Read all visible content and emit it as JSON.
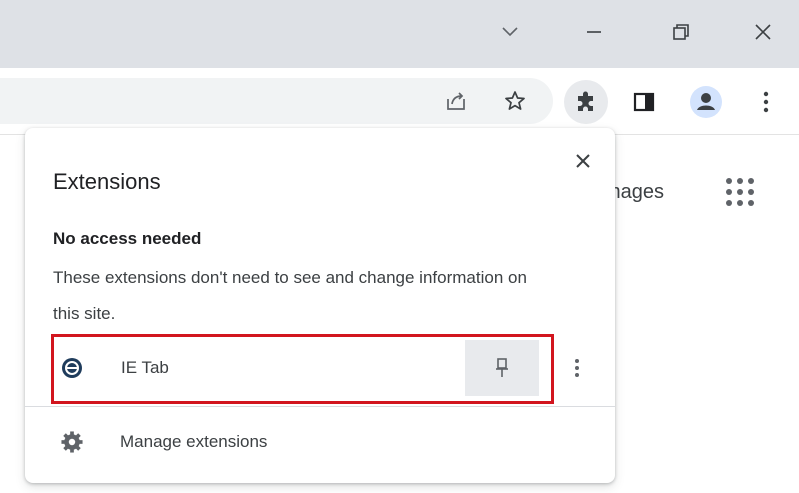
{
  "browser": {
    "images_link": "mages"
  },
  "popup": {
    "title": "Extensions",
    "section_heading": "No access needed",
    "section_description": "These extensions don't need to see and change information on this site.",
    "extensions": [
      {
        "name": "IE Tab",
        "icon": "ie-tab-icon",
        "pinned": false
      }
    ],
    "manage_label": "Manage extensions"
  },
  "colors": {
    "highlight": "#d2151e",
    "titlebar": "#dee1e6",
    "pin_bg": "#e8eaed"
  }
}
